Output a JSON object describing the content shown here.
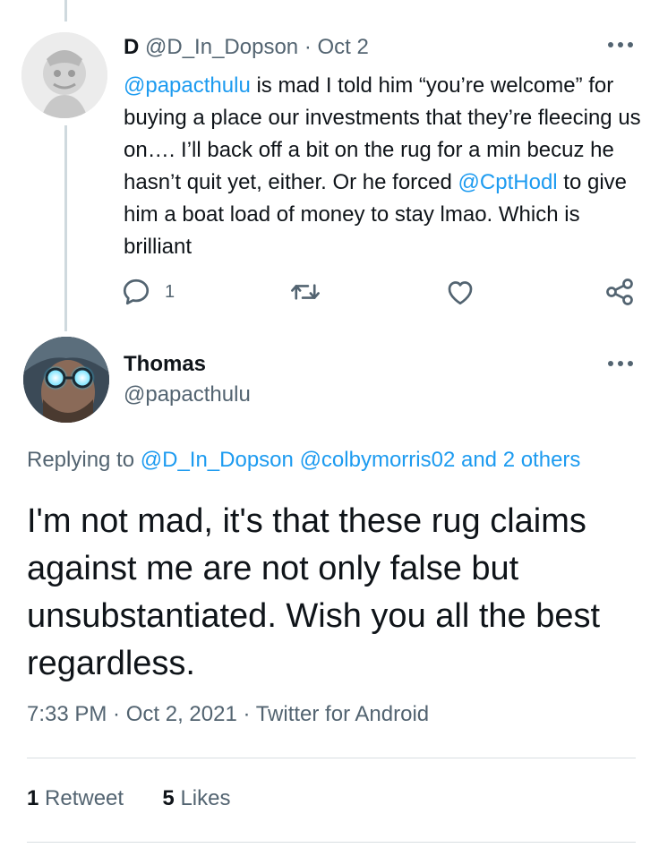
{
  "parent_tweet": {
    "name": "D",
    "handle": "@D_In_Dopson",
    "separator": "·",
    "date": "Oct 2",
    "body": {
      "mention1": "@papacthulu",
      "text1": " is mad I told him “you’re welcome” for buying a place our investments that they’re fleecing us on…. I’ll back off a bit on the rug for a min becuz he hasn’t quit yet, either. Or he forced ",
      "mention2": "@CptHodl",
      "text2": " to give him a boat load of money to stay lmao. Which is brilliant"
    },
    "actions": {
      "reply_count": "1",
      "icons": [
        "reply-icon",
        "retweet-icon",
        "like-icon",
        "share-icon"
      ]
    }
  },
  "main_tweet": {
    "name": "Thomas",
    "handle": "@papacthulu",
    "replying": {
      "prefix": "Replying to ",
      "user1": "@D_In_Dopson",
      "user2": "@colbymorris02",
      "rest": " and 2 others"
    },
    "body": "I'm not mad, it's that these rug claims against me are not only false but unsubstantiated. Wish you all the best regardless.",
    "time": "7:33 PM",
    "date": "Oct 2, 2021",
    "source": "Twitter for Android",
    "meta_separator": " · ",
    "retweet_count": "1",
    "retweet_label": "Retweet",
    "like_count": "5",
    "like_label": "Likes"
  },
  "colors": {
    "accent": "#1d9bf0",
    "text": "#0f1419",
    "secondary": "#536471",
    "thread_line": "#cfd9de"
  }
}
